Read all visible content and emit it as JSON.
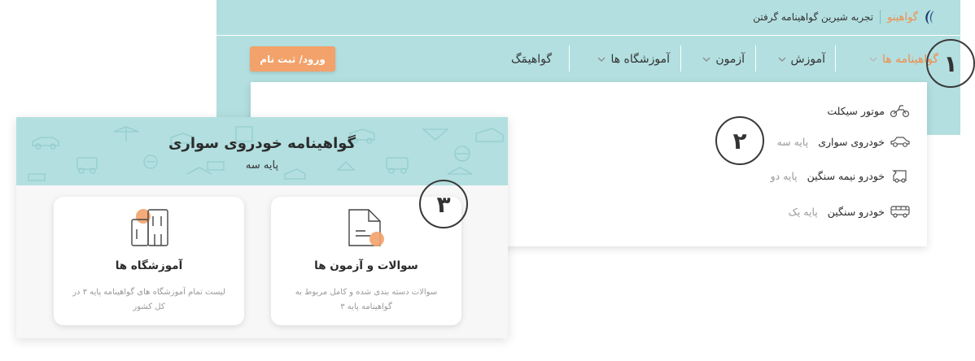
{
  "site": {
    "brand_name": "گواهینو",
    "tagline": "تجربه شیرین گواهینامه گرفتن",
    "login_label": "ورود/ ثبت نام"
  },
  "nav": {
    "items": [
      {
        "label": "گواهینامه ها",
        "has_dropdown": true,
        "active": true
      },
      {
        "label": "آموزش",
        "has_dropdown": true
      },
      {
        "label": "آزمون",
        "has_dropdown": true
      },
      {
        "label": "آموزشگاه ها",
        "has_dropdown": true
      },
      {
        "label": "گواهیمَگ",
        "has_dropdown": false
      }
    ]
  },
  "dropdown": {
    "items": [
      {
        "label": "موتور سیکلت",
        "sub": "",
        "icon": "motorcycle-icon"
      },
      {
        "label": "خودروی سواری",
        "sub": "پایه سه",
        "icon": "car-icon"
      },
      {
        "label": "خودرو نیمه سنگین",
        "sub": "پایه دو",
        "icon": "truck-icon"
      },
      {
        "label": "خودرو سنگین",
        "sub": "پایه یک",
        "icon": "bus-icon"
      }
    ]
  },
  "markers": [
    "۱",
    "۲",
    "۳"
  ],
  "card": {
    "title": "گواهینامه خودروی سواری",
    "subtitle": "پایه سه",
    "features": [
      {
        "title": "سوالات و آزمون ها",
        "desc": "سوالات دسته بندی شده و کامل مربوط به گواهینامه پایه ۳",
        "icon": "document-icon"
      },
      {
        "title": "آموزشگاه ها",
        "desc": "لیست تمام آموزشگاه های گواهینامه پایه ۳ در کل کشور",
        "icon": "building-icon"
      }
    ]
  },
  "colors": {
    "accent": "#ef8d4a",
    "panel": "#b3dfe0",
    "button": "#f2a26a"
  }
}
